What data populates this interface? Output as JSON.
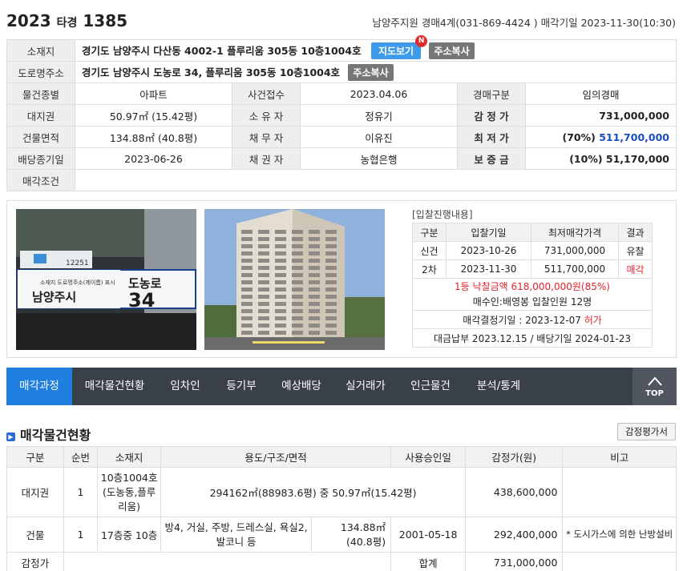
{
  "header": {
    "year": "2023",
    "case_type": "타경",
    "case_num": "1385",
    "court": "남양주지원 경매4계(031-869-4424 ) 매각기일 2023-11-30(10:30)"
  },
  "info": {
    "address_label": "소재지",
    "address": "경기도 남양주시 다산동 4002-1 플루리움 305동 10층1004호",
    "map_btn": "지도보기",
    "new_badge": "N",
    "copy_btn": "주소복사",
    "road_label": "도로명주소",
    "road": "경기도 남양주시 도농로 34, 플루리움 305동 10층1004호",
    "road_copy_btn": "주소복사",
    "rows": [
      {
        "l1": "물건종별",
        "v1": "아파트",
        "l2": "사건접수",
        "v2": "2023.04.06",
        "l3": "경매구분",
        "v3": "임의경매"
      },
      {
        "l1": "대지권",
        "v1": "50.97㎡ (15.42평)",
        "l2": "소 유 자",
        "v2": "정유기",
        "l3": "감 정 가",
        "v3": "731,000,000"
      },
      {
        "l1": "건물면적",
        "v1": "134.88㎡ (40.8평)",
        "l2": "채 무 자",
        "v2": "이유진",
        "l3": "최 저 가",
        "v3_pre": "(70%) ",
        "v3": "511,700,000"
      },
      {
        "l1": "배당종기일",
        "v1": "2023-06-26",
        "l2": "채 권 자",
        "v2": "농협은행",
        "l3": "보 증 금",
        "v3": "(10%) 51,170,000"
      }
    ],
    "cond_label": "매각조건",
    "cond": ""
  },
  "photo1": {
    "sign_region": "남양주시",
    "sign_road": "도농로",
    "sign_num": "34",
    "sign_small": "소재지 도로명주소(제이름) 표시",
    "sign_code": "12251"
  },
  "bid": {
    "caption": "[입찰진행내용]",
    "headers": [
      "구분",
      "입찰기일",
      "최저매각가격",
      "결과"
    ],
    "rows": [
      {
        "round": "신건",
        "date": "2023-10-26",
        "price": "731,000,000",
        "result": "유찰"
      },
      {
        "round": "2차",
        "date": "2023-11-30",
        "price": "511,700,000",
        "result": "매각"
      }
    ],
    "winning": "1등 낙찰금액 618,000,000원(85%)",
    "buyer": "매수인:배영봉 입찰인원 12명",
    "decision_pre": "매각결정기일 : 2023-12-07 ",
    "decision_status": "허가",
    "payment": "대금납부 2023.12.15 / 배당기일 2024-01-23"
  },
  "tabs": [
    "매각과정",
    "매각물건현황",
    "임차인",
    "등기부",
    "예상배당",
    "실거래가",
    "인근물건",
    "분석/통계"
  ],
  "top_label": "TOP",
  "section": {
    "title": "매각물건현황",
    "appraisal_btn": "감정평가서"
  },
  "items": {
    "headers": [
      "구분",
      "순번",
      "소재지",
      "용도/구조/면적",
      "사용승인일",
      "감정가(원)",
      "비고"
    ],
    "land": {
      "type": "대지권",
      "no": "1",
      "loc": "10층1004호 (도농동,플루리움)",
      "desc": "294162㎡(88983.6평) 중 50.97㎡(15.42평)",
      "price": "438,600,000"
    },
    "bldg": {
      "type": "건물",
      "no": "1",
      "loc": "17층중 10층",
      "use": "방4, 거실, 주방, 드레스실, 욕실2, 발코니 등",
      "area": "134.88㎡ (40.8평)",
      "date": "2001-05-18",
      "price": "292,400,000",
      "note": "* 도시가스에 의한 난방설비"
    },
    "total": {
      "label": "감정가",
      "sum_label": "합계",
      "sum": "731,000,000"
    }
  }
}
